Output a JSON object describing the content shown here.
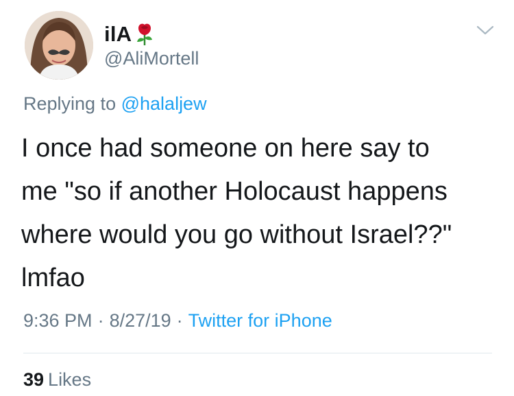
{
  "author": {
    "display_name": "ilA",
    "handle": "@AliMortell",
    "name_emoji_icon": "rose-icon",
    "avatar_icon": "profile-photo-mustache"
  },
  "menu": {
    "icon": "chevron-down-icon"
  },
  "reply": {
    "prefix": "Replying to",
    "to_handle": "@halaljew"
  },
  "tweet": {
    "text": "I once had someone on here say to\nme \"so if another Holocaust happens\nwhere would you go without Israel??\"\nlmfao"
  },
  "meta": {
    "time": "9:36 PM",
    "separator": "·",
    "date": "8/27/19",
    "source": "Twitter for iPhone"
  },
  "stats": {
    "likes_count": "39",
    "likes_label": "Likes"
  },
  "colors": {
    "text": "#14171a",
    "secondary": "#657786",
    "link": "#1da1f2",
    "divider": "#e1e8ed"
  }
}
